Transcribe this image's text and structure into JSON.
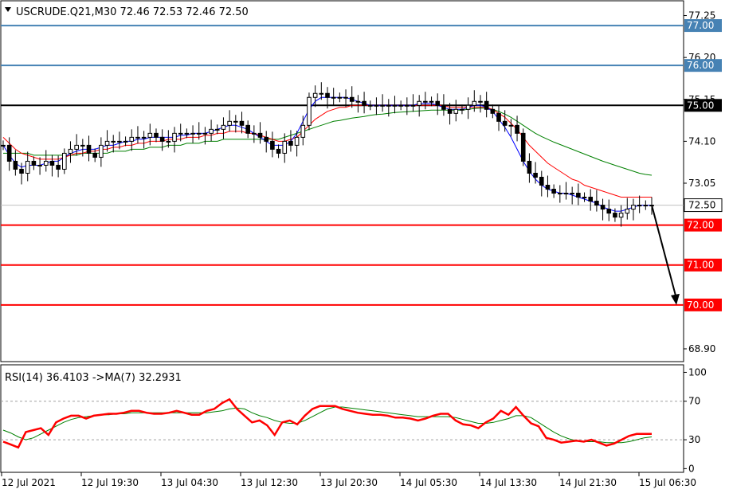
{
  "header": {
    "symbol_line": "USCRUDE.Q21,M30  72.46 72.53 72.46 72.50"
  },
  "rsi_panel": {
    "label": "RSI(14) 36.4103  ->MA(7) 32.2931"
  },
  "colors": {
    "background": "#ffffff",
    "grid_border": "#000000",
    "candle": "#000000",
    "ma_fast": "#0000ff",
    "ma_mid": "#ff0000",
    "ma_slow": "#008000",
    "level_blue": "#4682b4",
    "level_red": "#ff0000",
    "level_black": "#000000",
    "rsi": "#ff0000",
    "rsi_ma": "#008000"
  },
  "chart_data": [
    {
      "type": "candlestick",
      "title": "USCRUDE.Q21,M30",
      "y_axis": {
        "ylim": [
          68.6,
          77.6
        ],
        "tick_labels": [
          {
            "value": 77.25,
            "label": "77.25"
          },
          {
            "value": 76.2,
            "label": "76.20"
          },
          {
            "value": 75.15,
            "label": "75.15"
          },
          {
            "value": 74.1,
            "label": "74.10"
          },
          {
            "value": 73.05,
            "label": "73.05"
          },
          {
            "value": 68.9,
            "label": "68.90"
          }
        ],
        "position": "right"
      },
      "x_axis": {
        "tick_labels": [
          "12 Jul 2021",
          "12 Jul 19:30",
          "13 Jul 04:30",
          "13 Jul 12:30",
          "13 Jul 20:30",
          "14 Jul 05:30",
          "14 Jul 13:30",
          "14 Jul 21:30",
          "15 Jul 06:30"
        ]
      },
      "current_price": {
        "value": 72.5,
        "label": "72.50"
      },
      "horizontal_levels": [
        {
          "value": 77.0,
          "label": "77.00",
          "color": "#4682b4"
        },
        {
          "value": 76.0,
          "label": "76.00",
          "color": "#4682b4"
        },
        {
          "value": 75.0,
          "label": "75.00",
          "color": "#000000"
        },
        {
          "value": 72.0,
          "label": "72.00",
          "color": "#ff0000"
        },
        {
          "value": 71.0,
          "label": "71.00",
          "color": "#ff0000"
        },
        {
          "value": 70.0,
          "label": "70.00",
          "color": "#ff0000"
        }
      ],
      "forecast_arrow": {
        "from": 72.5,
        "to": 70.0,
        "direction": "down"
      },
      "close_series": [
        74.0,
        73.6,
        73.4,
        73.3,
        73.6,
        73.5,
        73.5,
        73.6,
        73.5,
        73.4,
        73.8,
        73.9,
        74.0,
        74.0,
        73.8,
        73.7,
        74.0,
        74.1,
        74.1,
        74.1,
        74.1,
        74.2,
        74.2,
        74.2,
        74.3,
        74.2,
        74.1,
        74.1,
        74.3,
        74.3,
        74.3,
        74.3,
        74.3,
        74.3,
        74.4,
        74.4,
        74.5,
        74.6,
        74.6,
        74.5,
        74.3,
        74.3,
        74.2,
        74.1,
        73.9,
        73.8,
        74.1,
        74.0,
        74.2,
        74.5,
        75.2,
        75.3,
        75.3,
        75.2,
        75.2,
        75.2,
        75.2,
        75.1,
        75.1,
        75.0,
        75.0,
        75.0,
        75.0,
        75.0,
        75.0,
        75.0,
        75.0,
        75.0,
        75.1,
        75.1,
        75.1,
        75.0,
        74.9,
        74.8,
        74.9,
        74.9,
        75.0,
        75.1,
        75.1,
        74.9,
        74.8,
        74.6,
        74.5,
        74.5,
        74.3,
        73.6,
        73.3,
        73.2,
        73.0,
        72.9,
        72.8,
        72.8,
        72.8,
        72.8,
        72.7,
        72.7,
        72.6,
        72.5,
        72.4,
        72.3,
        72.2,
        72.3,
        72.4,
        72.5,
        72.5,
        72.5,
        72.5
      ],
      "ma_fast": [
        74.0,
        73.75,
        73.55,
        73.45,
        73.5,
        73.5,
        73.5,
        73.55,
        73.6,
        73.6,
        73.7,
        73.8,
        73.85,
        73.9,
        73.9,
        73.9,
        73.95,
        74.0,
        74.0,
        74.05,
        74.1,
        74.1,
        74.15,
        74.15,
        74.2,
        74.2,
        74.2,
        74.2,
        74.2,
        74.25,
        74.25,
        74.3,
        74.3,
        74.3,
        74.35,
        74.4,
        74.45,
        74.5,
        74.5,
        74.45,
        74.4,
        74.3,
        74.2,
        74.1,
        74.0,
        74.0,
        74.0,
        74.1,
        74.3,
        74.6,
        74.9,
        75.1,
        75.2,
        75.2,
        75.2,
        75.2,
        75.2,
        75.15,
        75.1,
        75.05,
        75.0,
        75.0,
        75.0,
        75.0,
        75.0,
        75.0,
        75.0,
        75.0,
        75.05,
        75.05,
        75.05,
        75.0,
        74.95,
        74.9,
        74.9,
        74.9,
        74.95,
        75.0,
        75.0,
        74.95,
        74.85,
        74.65,
        74.45,
        74.2,
        73.9,
        73.6,
        73.35,
        73.15,
        73.0,
        72.9,
        72.85,
        72.8,
        72.8,
        72.75,
        72.7,
        72.65,
        72.6,
        72.55,
        72.45,
        72.4,
        72.35,
        72.35,
        72.4,
        72.45,
        72.5,
        72.5,
        72.5
      ],
      "ma_mid": [
        74.2,
        74.05,
        73.9,
        73.8,
        73.75,
        73.7,
        73.65,
        73.65,
        73.65,
        73.65,
        73.7,
        73.75,
        73.8,
        73.8,
        73.85,
        73.85,
        73.9,
        73.9,
        73.95,
        73.95,
        74.0,
        74.0,
        74.05,
        74.05,
        74.1,
        74.1,
        74.1,
        74.15,
        74.15,
        74.15,
        74.2,
        74.2,
        74.2,
        74.25,
        74.25,
        74.3,
        74.3,
        74.35,
        74.35,
        74.35,
        74.3,
        74.3,
        74.25,
        74.2,
        74.15,
        74.1,
        74.1,
        74.15,
        74.2,
        74.35,
        74.5,
        74.65,
        74.75,
        74.85,
        74.9,
        74.95,
        74.95,
        75.0,
        75.0,
        75.0,
        75.0,
        75.0,
        75.0,
        75.0,
        75.0,
        75.0,
        75.0,
        75.0,
        75.0,
        75.0,
        75.0,
        75.0,
        75.0,
        74.95,
        74.95,
        74.95,
        74.95,
        74.95,
        74.95,
        74.95,
        74.9,
        74.8,
        74.7,
        74.55,
        74.4,
        74.2,
        74.0,
        73.85,
        73.7,
        73.55,
        73.45,
        73.35,
        73.25,
        73.15,
        73.1,
        73.0,
        72.95,
        72.9,
        72.85,
        72.8,
        72.75,
        72.7,
        72.7,
        72.7,
        72.7,
        72.7,
        72.7
      ],
      "ma_slow": [
        73.8,
        73.8,
        73.8,
        73.8,
        73.8,
        73.75,
        73.75,
        73.75,
        73.75,
        73.75,
        73.75,
        73.75,
        73.75,
        73.8,
        73.8,
        73.8,
        73.8,
        73.8,
        73.85,
        73.85,
        73.85,
        73.9,
        73.9,
        73.9,
        73.95,
        73.95,
        73.95,
        74.0,
        74.0,
        74.0,
        74.05,
        74.05,
        74.05,
        74.1,
        74.1,
        74.1,
        74.15,
        74.15,
        74.15,
        74.15,
        74.15,
        74.15,
        74.15,
        74.15,
        74.15,
        74.15,
        74.2,
        74.25,
        74.3,
        74.35,
        74.4,
        74.45,
        74.5,
        74.55,
        74.6,
        74.62,
        74.65,
        74.68,
        74.7,
        74.72,
        74.75,
        74.77,
        74.78,
        74.8,
        74.82,
        74.83,
        74.84,
        74.85,
        74.86,
        74.87,
        74.88,
        74.88,
        74.88,
        74.88,
        74.88,
        74.88,
        74.9,
        74.92,
        74.93,
        74.93,
        74.9,
        74.85,
        74.78,
        74.7,
        74.6,
        74.5,
        74.4,
        74.3,
        74.22,
        74.15,
        74.08,
        74.02,
        73.96,
        73.9,
        73.84,
        73.78,
        73.72,
        73.66,
        73.6,
        73.55,
        73.5,
        73.45,
        73.4,
        73.35,
        73.3,
        73.27,
        73.25
      ]
    },
    {
      "type": "line",
      "title": "RSI(14) 36.4103  ->MA(7) 32.2931",
      "y_axis": {
        "ylim": [
          -3,
          107
        ],
        "tick_labels": [
          {
            "value": 100,
            "label": "100"
          },
          {
            "value": 70,
            "label": "70"
          },
          {
            "value": 30,
            "label": "30"
          },
          {
            "value": 0,
            "label": "0"
          }
        ],
        "position": "right"
      },
      "reference_lines": [
        70,
        30
      ],
      "series": [
        {
          "values": [
            28,
            25,
            22,
            38,
            40,
            42,
            35,
            48,
            52,
            55,
            55,
            52,
            55,
            56,
            57,
            57,
            58,
            60,
            60,
            58,
            57,
            57,
            58,
            60,
            58,
            56,
            56,
            60,
            62,
            68,
            72,
            62,
            55,
            48,
            50,
            45,
            35,
            48,
            50,
            46,
            55,
            62,
            65,
            65,
            65,
            62,
            60,
            58,
            57,
            56,
            56,
            55,
            53,
            53,
            52,
            50,
            52,
            55,
            57,
            57,
            50,
            46,
            45,
            42,
            48,
            52,
            60,
            56,
            64,
            55,
            47,
            44,
            32,
            30,
            27,
            28,
            29,
            28,
            30,
            27,
            24,
            26,
            30,
            34,
            36,
            36,
            36
          ]
        },
        {
          "values": [
            40,
            37,
            33,
            30,
            32,
            36,
            40,
            44,
            48,
            51,
            53,
            54,
            55,
            56,
            56,
            57,
            57,
            58,
            58,
            58,
            58,
            58,
            58,
            58,
            58,
            58,
            58,
            58,
            59,
            60,
            62,
            63,
            62,
            58,
            55,
            53,
            50,
            48,
            47,
            47,
            50,
            54,
            58,
            62,
            64,
            64,
            63,
            62,
            61,
            60,
            59,
            58,
            57,
            56,
            55,
            54,
            54,
            54,
            54,
            54,
            53,
            51,
            49,
            47,
            47,
            48,
            50,
            52,
            55,
            55,
            53,
            48,
            43,
            38,
            34,
            31,
            29,
            28,
            28,
            28,
            27,
            27,
            27,
            28,
            30,
            32,
            33
          ]
        }
      ]
    }
  ]
}
